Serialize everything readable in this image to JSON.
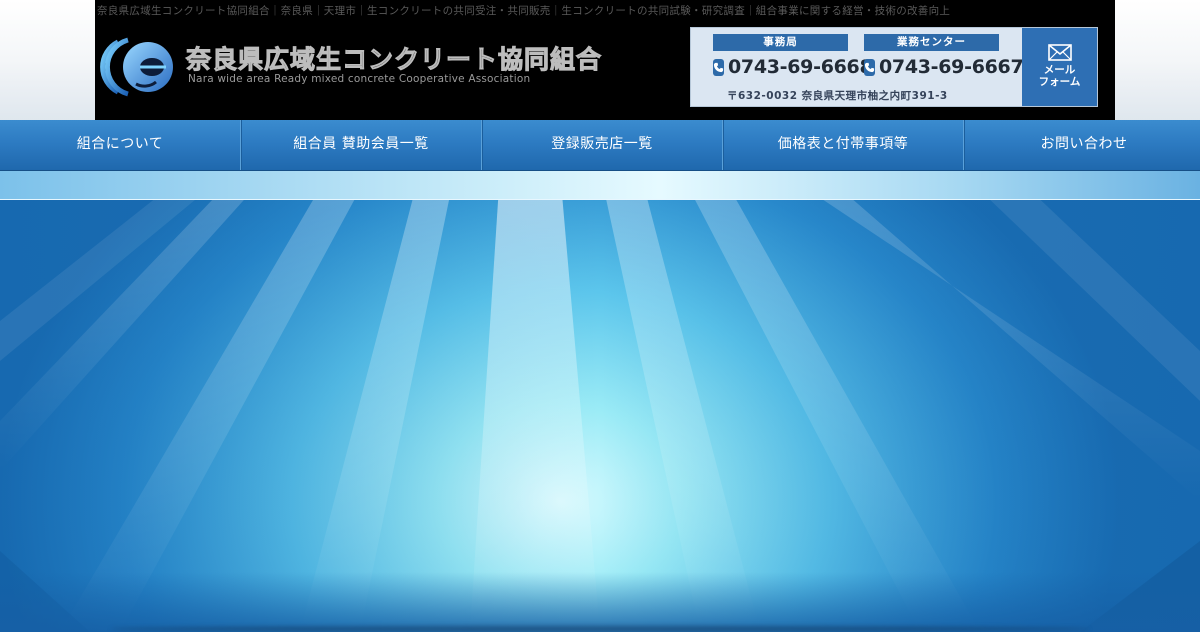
{
  "site": {
    "tagline": "奈良県広域生コンクリート協同組合｜奈良県｜天理市｜生コンクリートの共同受注・共同販売｜生コンクリートの共同試験・研究調査｜組合事業に関する経営・技術の改善向上",
    "logo_title": "奈良県広域生コンクリート協同組合",
    "logo_subtitle": "Nara wide area Ready mixed concrete Cooperative Association"
  },
  "contact": {
    "office": {
      "label": "事務局",
      "phone": "0743-69-6668"
    },
    "center": {
      "label": "業務センター",
      "phone": "0743-69-6667"
    },
    "address": "〒632-0032 奈良県天理市柚之内町391-3",
    "mail_button": "メール\nフォーム"
  },
  "nav": {
    "items": [
      {
        "label": "組合について"
      },
      {
        "label": "組合員 賛助会員一覧"
      },
      {
        "label": "登録販売店一覧"
      },
      {
        "label": "価格表と付帯事項等"
      },
      {
        "label": "お問い合わせ"
      }
    ]
  },
  "colors": {
    "header_bg": "#000000",
    "accent_blue": "#2e6fb4",
    "nav_blue": "#2d7bc2"
  },
  "icons": {
    "logo": "logo-mark-icon",
    "phone": "phone-icon",
    "mail": "mail-icon"
  }
}
